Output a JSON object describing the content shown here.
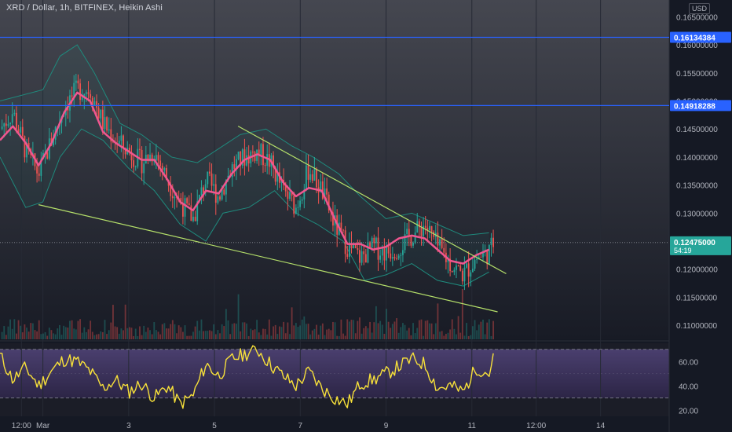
{
  "chart_data": {
    "type": "candlestick",
    "title": "XRD / Dollar, 1h, BITFINEX, Heikin Ashi",
    "currency": "USD",
    "price_axis": {
      "ylim": [
        0.1075,
        0.168
      ],
      "ticks": [
        "0.16500000",
        "0.16000000",
        "0.15500000",
        "0.15000000",
        "0.14500000",
        "0.14000000",
        "0.13500000",
        "0.13000000",
        "0.12000000",
        "0.11500000",
        "0.11000000"
      ]
    },
    "time_axis": {
      "ticks": [
        {
          "label": "12:00",
          "t": 0.5
        },
        {
          "label": "Mar",
          "t": 1
        },
        {
          "label": "3",
          "t": 3
        },
        {
          "label": "5",
          "t": 5
        },
        {
          "label": "7",
          "t": 7
        },
        {
          "label": "9",
          "t": 9
        },
        {
          "label": "11",
          "t": 11
        },
        {
          "label": "12:00",
          "t": 12.5
        },
        {
          "label": "14",
          "t": 14
        }
      ],
      "xlim": [
        0,
        15.6
      ],
      "last_bar_t": 11.5
    },
    "horizontal_lines": [
      {
        "label": "0.16134384",
        "value": 0.16134384,
        "color": "#2962ff"
      },
      {
        "label": "0.14918288",
        "value": 0.14918288,
        "color": "#2962ff"
      }
    ],
    "last_price": {
      "label": "0.12475000",
      "value": 0.12475,
      "countdown": "54:19",
      "color": "#26a69a"
    },
    "trendlines": [
      {
        "t": [
          5.55,
          11.8
        ],
        "y": [
          0.1455,
          0.1192
        ],
        "color": "#b5e06a"
      },
      {
        "t": [
          0.9,
          11.6
        ],
        "y": [
          0.1315,
          0.1124
        ],
        "color": "#b5e06a"
      }
    ],
    "price_path": {
      "t": [
        0,
        0.3,
        0.6,
        0.9,
        1.2,
        1.5,
        1.8,
        2.1,
        2.4,
        2.7,
        3.0,
        3.3,
        3.6,
        3.9,
        4.2,
        4.5,
        4.8,
        5.1,
        5.4,
        5.7,
        6.0,
        6.3,
        6.6,
        6.9,
        7.2,
        7.5,
        7.8,
        8.1,
        8.4,
        8.7,
        9.0,
        9.3,
        9.6,
        9.9,
        10.2,
        10.5,
        10.8,
        11.1,
        11.4,
        11.5
      ],
      "y": [
        0.145,
        0.148,
        0.141,
        0.137,
        0.143,
        0.149,
        0.152,
        0.152,
        0.146,
        0.143,
        0.141,
        0.139,
        0.141,
        0.136,
        0.132,
        0.129,
        0.136,
        0.133,
        0.138,
        0.14,
        0.141,
        0.139,
        0.134,
        0.131,
        0.138,
        0.134,
        0.128,
        0.124,
        0.122,
        0.124,
        0.123,
        0.124,
        0.126,
        0.128,
        0.124,
        0.121,
        0.119,
        0.122,
        0.123,
        0.1247
      ]
    },
    "moving_average": {
      "color": "#f0568f",
      "t": [
        0,
        0.3,
        0.6,
        0.9,
        1.2,
        1.5,
        1.8,
        2.1,
        2.4,
        2.7,
        3.0,
        3.3,
        3.6,
        3.9,
        4.2,
        4.5,
        4.8,
        5.1,
        5.4,
        5.7,
        6.0,
        6.3,
        6.6,
        6.9,
        7.2,
        7.5,
        7.8,
        8.1,
        8.4,
        8.7,
        9.0,
        9.3,
        9.6,
        9.9,
        10.2,
        10.5,
        10.8,
        11.1,
        11.4
      ],
      "y": [
        0.143,
        0.1455,
        0.1425,
        0.1385,
        0.1425,
        0.148,
        0.1515,
        0.15,
        0.1445,
        0.1425,
        0.141,
        0.1395,
        0.1395,
        0.136,
        0.132,
        0.1305,
        0.134,
        0.1335,
        0.137,
        0.1395,
        0.1405,
        0.1395,
        0.1355,
        0.133,
        0.1345,
        0.134,
        0.129,
        0.1245,
        0.1245,
        0.1235,
        0.124,
        0.1255,
        0.126,
        0.1255,
        0.1235,
        0.1215,
        0.121,
        0.1225,
        0.1235
      ]
    },
    "bollinger_upper": {
      "t": [
        0,
        1,
        1.4,
        1.8,
        2.2,
        2.8,
        3.3,
        4.0,
        4.6,
        5.0,
        5.6,
        6.2,
        6.8,
        7.3,
        7.9,
        8.4,
        9.0,
        9.6,
        10.2,
        10.8,
        11.4
      ],
      "y": [
        0.15,
        0.152,
        0.158,
        0.16,
        0.155,
        0.146,
        0.144,
        0.14,
        0.139,
        0.141,
        0.144,
        0.145,
        0.142,
        0.14,
        0.137,
        0.133,
        0.129,
        0.13,
        0.128,
        0.126,
        0.1265
      ]
    },
    "bollinger_lower": {
      "t": [
        0,
        0.6,
        1.0,
        1.4,
        1.9,
        2.4,
        3.0,
        3.6,
        4.2,
        4.8,
        5.2,
        5.8,
        6.4,
        6.9,
        7.4,
        8.0,
        8.5,
        9.0,
        9.6,
        10.2,
        10.8,
        11.4
      ],
      "y": [
        0.14,
        0.131,
        0.132,
        0.14,
        0.145,
        0.143,
        0.138,
        0.134,
        0.128,
        0.125,
        0.13,
        0.131,
        0.134,
        0.13,
        0.128,
        0.125,
        0.118,
        0.119,
        0.121,
        0.118,
        0.117,
        0.1195
      ]
    },
    "rsi": {
      "ylim": [
        15,
        75
      ],
      "ticks": [
        "60.00",
        "40.00",
        "20.00"
      ],
      "levels": [
        70,
        30
      ],
      "t": [
        0,
        0.3,
        0.6,
        0.9,
        1.2,
        1.5,
        1.8,
        2.1,
        2.4,
        2.7,
        3.0,
        3.3,
        3.6,
        3.9,
        4.2,
        4.5,
        4.8,
        5.1,
        5.4,
        5.7,
        6.0,
        6.3,
        6.6,
        6.9,
        7.2,
        7.5,
        7.8,
        8.1,
        8.4,
        8.7,
        9.0,
        9.3,
        9.6,
        9.9,
        10.2,
        10.5,
        10.8,
        11.1,
        11.4,
        11.5
      ],
      "y": [
        65,
        45,
        55,
        40,
        52,
        62,
        60,
        52,
        38,
        45,
        35,
        42,
        30,
        40,
        25,
        32,
        58,
        48,
        62,
        66,
        70,
        58,
        48,
        40,
        52,
        38,
        30,
        25,
        42,
        45,
        50,
        56,
        62,
        58,
        38,
        40,
        35,
        55,
        50,
        62
      ]
    }
  }
}
